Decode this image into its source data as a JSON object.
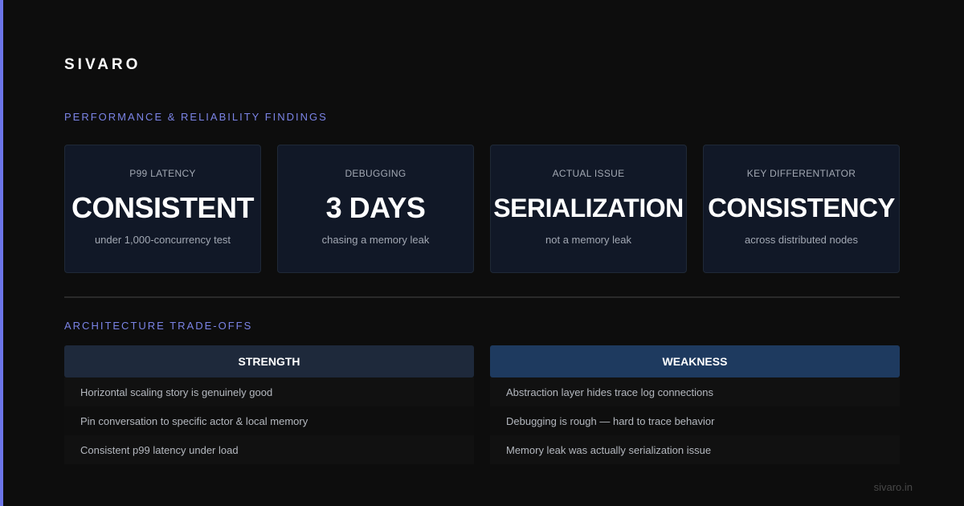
{
  "brand": "SIVARO",
  "findings_title": "PERFORMANCE & RELIABILITY FINDINGS",
  "metrics": [
    {
      "label": "P99 LATENCY",
      "value": "CONSISTENT",
      "note": "under 1,000-concurrency test"
    },
    {
      "label": "DEBUGGING",
      "value": "3 DAYS",
      "note": "chasing a memory leak"
    },
    {
      "label": "ACTUAL ISSUE",
      "value": "SERIALIZATION",
      "note": "not a memory leak"
    },
    {
      "label": "KEY DIFFERENTIATOR",
      "value": "CONSISTENCY",
      "note": "across distributed nodes"
    }
  ],
  "tradeoffs_title": "ARCHITECTURE TRADE-OFFS",
  "strength": {
    "header": "STRENGTH",
    "items": [
      "Horizontal scaling story is genuinely good",
      "Pin conversation to specific actor & local memory",
      "Consistent p99 latency under load"
    ]
  },
  "weakness": {
    "header": "WEAKNESS",
    "items": [
      "Abstraction layer hides trace log connections",
      "Debugging is rough — hard to trace behavior",
      "Memory leak was actually serialization issue"
    ]
  },
  "footer": "sivaro.in",
  "colors": {
    "background": "#0d0d0d",
    "accent": "#6c75e8",
    "card_bg": "#111827",
    "strength_header": "#1e293b",
    "weakness_header": "#1e3a5f"
  }
}
